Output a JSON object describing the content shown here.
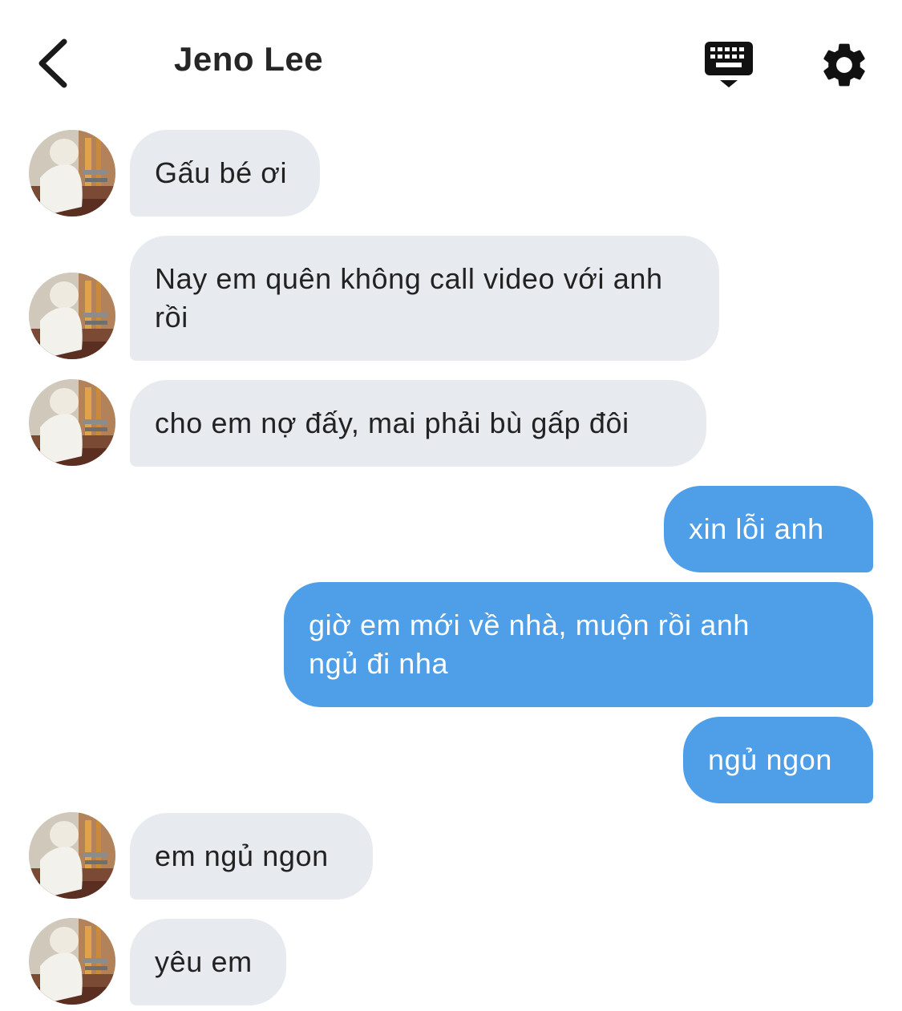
{
  "header": {
    "title": "Jeno Lee",
    "back_icon": "chevron-left-icon",
    "keyboard_icon": "keyboard-icon",
    "settings_icon": "gear-icon"
  },
  "colors": {
    "incoming_bubble": "#e7ebef",
    "outgoing_bubble": "#4f9ee8",
    "outgoing_text": "#ffffff",
    "incoming_text": "#222222"
  },
  "messages": [
    {
      "direction": "incoming",
      "text": "Gấu bé ơi"
    },
    {
      "direction": "incoming",
      "text": "Nay em quên không call video với anh rồi"
    },
    {
      "direction": "incoming",
      "text": "cho em nợ đấy, mai phải bù gấp đôi"
    },
    {
      "direction": "outgoing",
      "text": "xin lỗi anh"
    },
    {
      "direction": "outgoing",
      "text": "giờ em mới về nhà, muộn rồi anh ngủ đi nha"
    },
    {
      "direction": "outgoing",
      "text": "ngủ ngon"
    },
    {
      "direction": "incoming",
      "text": "em ngủ ngon"
    },
    {
      "direction": "incoming",
      "text": "yêu em"
    }
  ]
}
